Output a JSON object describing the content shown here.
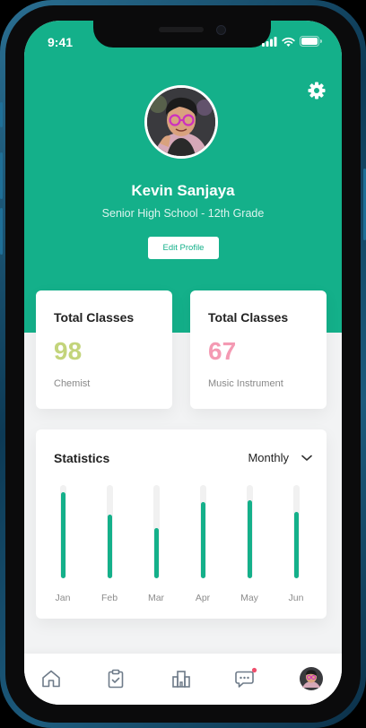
{
  "status_bar": {
    "time": "9:41"
  },
  "profile": {
    "name": "Kevin Sanjaya",
    "subtitle": "Senior High School - 12th Grade",
    "edit_label": "Edit Profile"
  },
  "cards": [
    {
      "title": "Total Classes",
      "value": "98",
      "subject": "Chemist",
      "color": "#c3d47b"
    },
    {
      "title": "Total Classes",
      "value": "67",
      "subject": "Music Instrument",
      "color": "#f49ab3"
    }
  ],
  "statistics": {
    "title": "Statistics",
    "period": "Monthly",
    "months": [
      "Jan",
      "Feb",
      "Mar",
      "Apr",
      "May",
      "Jun"
    ],
    "progress": [
      0.92,
      0.68,
      0.54,
      0.82,
      0.84,
      0.71
    ]
  },
  "nav": {
    "items": [
      "home-icon",
      "clipboard-check-icon",
      "school-icon",
      "chat-icon",
      "profile-avatar"
    ]
  },
  "colors": {
    "accent": "#14b08a",
    "notification": "#ef4f6c"
  }
}
